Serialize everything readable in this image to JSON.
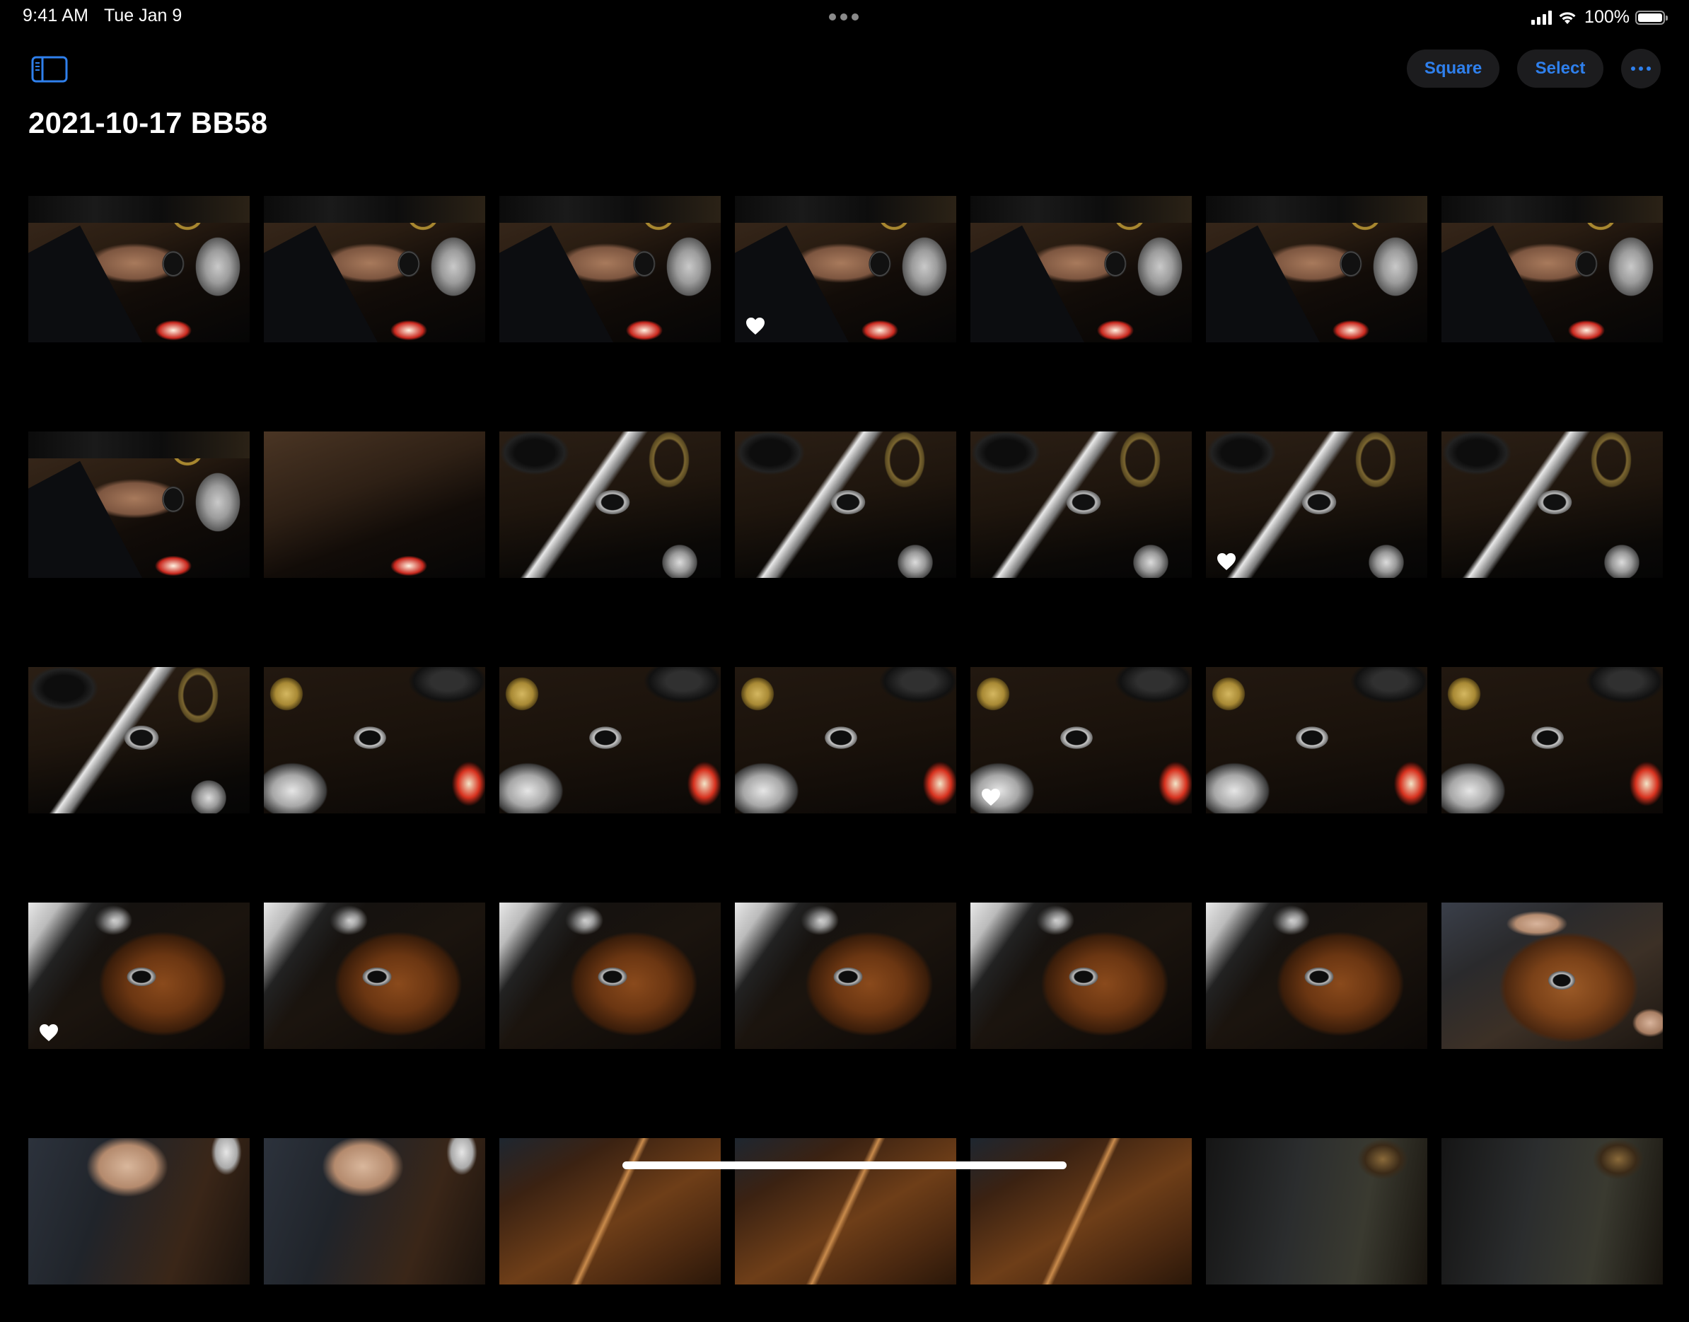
{
  "status_bar": {
    "time": "9:41 AM",
    "date": "Tue Jan 9",
    "battery_percent": "100%",
    "battery_level": 1.0,
    "signal_bars": 4,
    "icons": [
      "cellular-signal-icon",
      "wifi-icon",
      "battery-icon"
    ]
  },
  "toolbar": {
    "sidebar_icon": "sidebar-toggle-icon",
    "square_label": "Square",
    "select_label": "Select",
    "more_icon": "ellipsis-icon"
  },
  "album": {
    "title": "2021-10-17 BB58"
  },
  "colors": {
    "accent": "#2f80ed",
    "button_background": "#1c1c1e",
    "background": "#000000",
    "favorite_heart": "#ffffff"
  },
  "grid": {
    "columns": 7,
    "rows": [
      [
        {
          "scene": "wrist",
          "favorite": false
        },
        {
          "scene": "wrist",
          "favorite": false
        },
        {
          "scene": "wrist",
          "favorite": false
        },
        {
          "scene": "wrist",
          "favorite": true
        },
        {
          "scene": "wrist",
          "favorite": false
        },
        {
          "scene": "wrist",
          "favorite": false
        },
        {
          "scene": "wrist",
          "favorite": false
        }
      ],
      [
        {
          "scene": "wrist",
          "favorite": false
        },
        {
          "scene": "wrist-empty",
          "favorite": false
        },
        {
          "scene": "knife",
          "favorite": false
        },
        {
          "scene": "knife",
          "favorite": false
        },
        {
          "scene": "knife",
          "favorite": false
        },
        {
          "scene": "knife",
          "favorite": true
        },
        {
          "scene": "knife",
          "favorite": false
        }
      ],
      [
        {
          "scene": "knife",
          "favorite": false
        },
        {
          "scene": "coin",
          "favorite": false
        },
        {
          "scene": "coin",
          "favorite": false
        },
        {
          "scene": "coin",
          "favorite": false
        },
        {
          "scene": "coin",
          "favorite": true
        },
        {
          "scene": "coin",
          "favorite": false
        },
        {
          "scene": "coin",
          "favorite": false
        }
      ],
      [
        {
          "scene": "tray",
          "favorite": true
        },
        {
          "scene": "tray",
          "favorite": false
        },
        {
          "scene": "tray",
          "favorite": false
        },
        {
          "scene": "tray",
          "favorite": false
        },
        {
          "scene": "tray",
          "favorite": false
        },
        {
          "scene": "tray",
          "favorite": false
        },
        {
          "scene": "hands",
          "favorite": false
        }
      ],
      [
        {
          "scene": "partial-hand",
          "favorite": false
        },
        {
          "scene": "partial-hand",
          "favorite": false
        },
        {
          "scene": "partial-leather",
          "favorite": false
        },
        {
          "scene": "partial-leather",
          "favorite": false
        },
        {
          "scene": "partial-leather",
          "favorite": false
        },
        {
          "scene": "partial-dark",
          "favorite": false
        },
        {
          "scene": "partial-dark",
          "favorite": false
        }
      ]
    ]
  }
}
